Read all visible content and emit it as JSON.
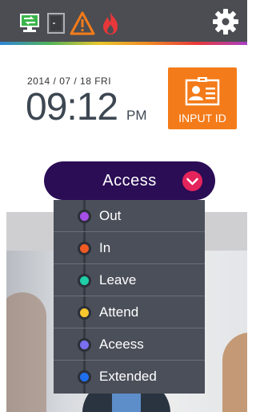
{
  "status_bar": {
    "icons": [
      "network-connected-icon",
      "door-icon",
      "warning-icon",
      "fire-icon"
    ],
    "settings_icon": "gear-icon",
    "colors": {
      "background": "#4b4d52",
      "network": "#3bb54a",
      "warning": "#f47b19",
      "fire": "#e8373a"
    }
  },
  "clock": {
    "date": "2014 / 07 / 18 FRI",
    "time": "09:12",
    "ampm": "PM"
  },
  "input_id_button": {
    "label": "INPUT ID",
    "icon": "id-card-icon",
    "color": "#f47b19"
  },
  "access_selector": {
    "label": "Access",
    "background": "#2b0d56",
    "chevron_color": "#e4245b"
  },
  "mode_options": [
    {
      "label": "Out",
      "color": "#a64ee8"
    },
    {
      "label": "In",
      "color": "#f25a24"
    },
    {
      "label": "Leave",
      "color": "#1ecfa8"
    },
    {
      "label": "Attend",
      "color": "#f7c72e"
    },
    {
      "label": "Aceess",
      "color": "#7a6ef0"
    },
    {
      "label": "Extended",
      "color": "#1f6ff0"
    }
  ]
}
